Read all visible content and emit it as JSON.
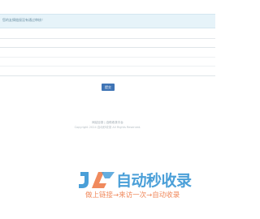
{
  "notice": {
    "message": "您的友情链接没有通过审核！"
  },
  "form": {
    "submit_label": "提交"
  },
  "footer": {
    "line1": "网站目录 | 自助收录平台",
    "line2": "Copyright 2024 自动秒收录 All Rights Reserved."
  },
  "watermark": {
    "brand": "自动秒收录",
    "tagline": "做上链接→来访一次→自动收录",
    "colors": {
      "blue": "#4a9fd8",
      "orange": "#f08a5d"
    }
  }
}
